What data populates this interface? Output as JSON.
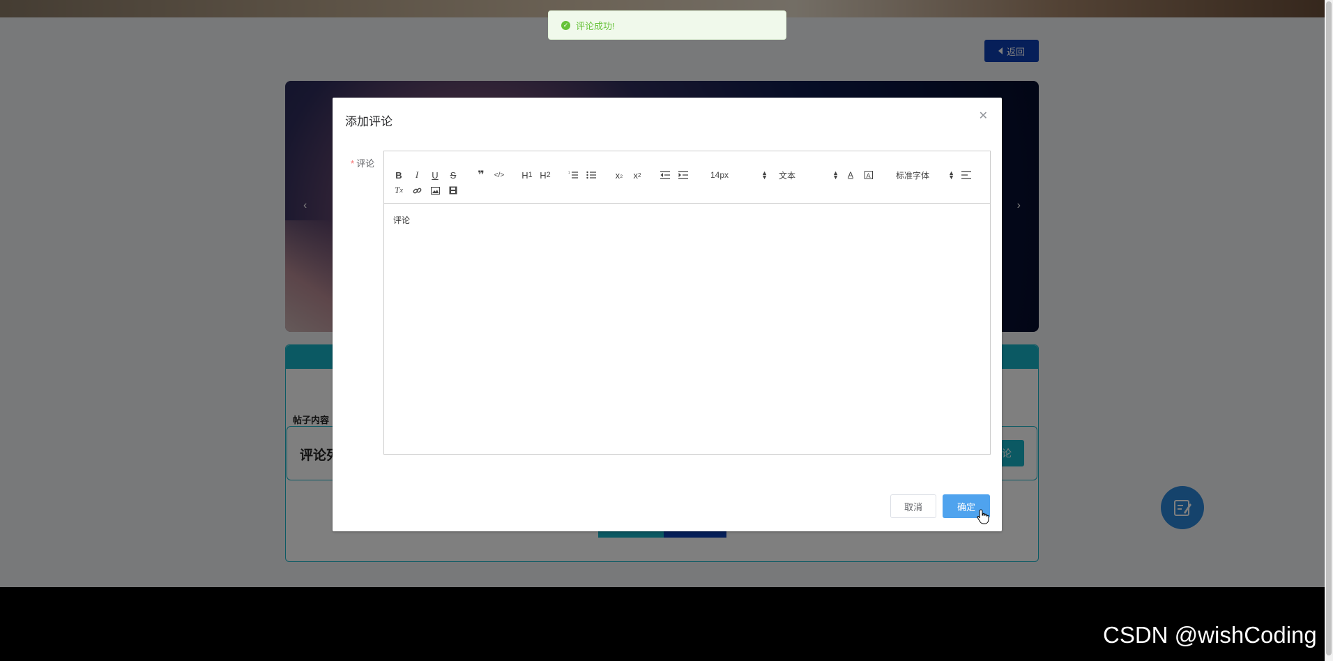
{
  "page": {
    "back_label": "返回",
    "post_content_label": "帖子内容",
    "comment_list_title": "评论列",
    "add_comment_label": "论"
  },
  "toast": {
    "message": "评论成功!",
    "color": "#67c23a"
  },
  "dialog": {
    "title": "添加评论",
    "close_icon": "close-icon",
    "field_label": "评论",
    "required_mark": "*",
    "editor": {
      "toolbar_row1": [
        "B",
        "I",
        "U",
        "S",
        "❝",
        "</>",
        "H1",
        "H2",
        "ol",
        "ul",
        "x₂",
        "x²",
        "outdent",
        "indent"
      ],
      "font_size_picker": "14px",
      "header_picker": "文本",
      "font_family_picker": "标准字体",
      "content": "评论"
    },
    "cancel_label": "取消",
    "confirm_label": "确定"
  },
  "watermark": "CSDN @wishCoding",
  "colors": {
    "primary": "#0d3fb3",
    "teal": "#16b3c6",
    "confirm": "#4fa3ee"
  }
}
